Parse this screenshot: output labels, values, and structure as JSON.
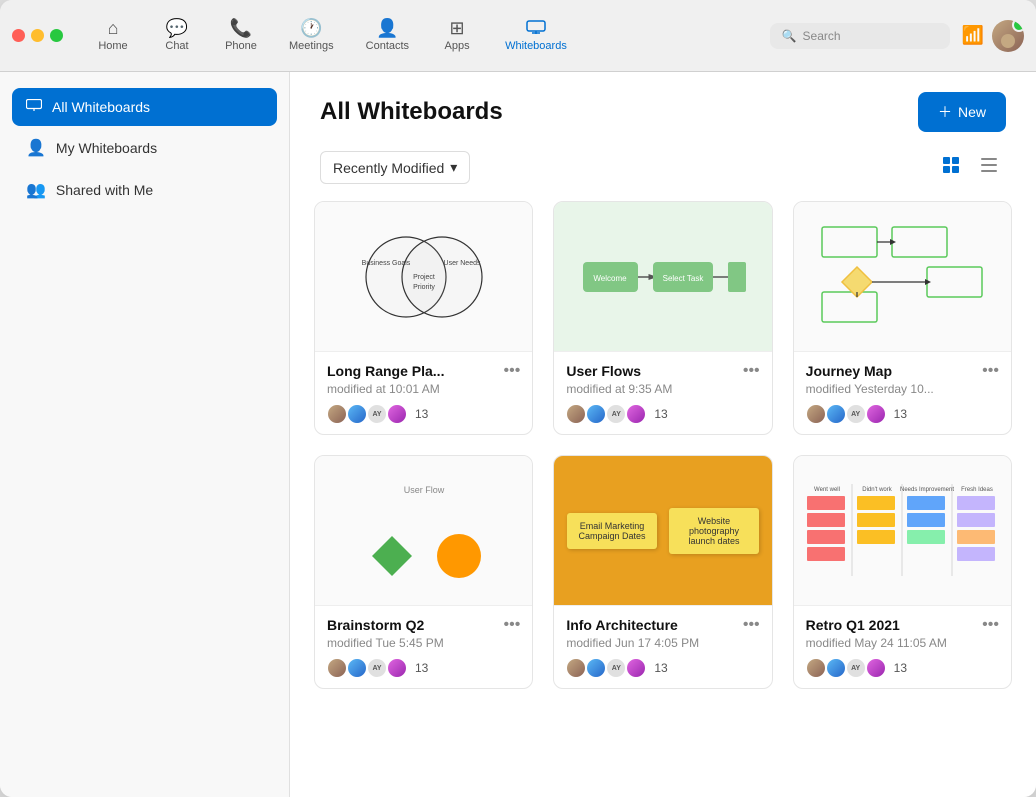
{
  "window": {
    "title": "Whiteboards"
  },
  "titlebar": {
    "traffic_lights": [
      "red",
      "yellow",
      "green"
    ],
    "nav": [
      {
        "id": "home",
        "label": "Home",
        "icon": "⌂"
      },
      {
        "id": "chat",
        "label": "Chat",
        "icon": "💬"
      },
      {
        "id": "phone",
        "label": "Phone",
        "icon": "📞"
      },
      {
        "id": "meetings",
        "label": "Meetings",
        "icon": "🕐"
      },
      {
        "id": "contacts",
        "label": "Contacts",
        "icon": "👤"
      },
      {
        "id": "apps",
        "label": "Apps",
        "icon": "⊞"
      },
      {
        "id": "whiteboards",
        "label": "Whiteboards",
        "icon": "▭",
        "active": true
      }
    ],
    "search": {
      "placeholder": "Search"
    },
    "new_button": "New"
  },
  "sidebar": {
    "items": [
      {
        "id": "all",
        "label": "All Whiteboards",
        "icon": "▭",
        "active": true
      },
      {
        "id": "my",
        "label": "My Whiteboards",
        "icon": "👤"
      },
      {
        "id": "shared",
        "label": "Shared with Me",
        "icon": "👥"
      }
    ]
  },
  "content": {
    "page_title": "All Whiteboards",
    "filter": {
      "label": "Recently Modified",
      "arrow": "▾"
    },
    "new_button": "New",
    "cards": [
      {
        "id": "long-range-plan",
        "title": "Long Range Pla...",
        "modified": "modified at 10:01 AM",
        "collaborators": 13,
        "thumbnail": "venn"
      },
      {
        "id": "user-flows",
        "title": "User Flows",
        "modified": "modified at 9:35 AM",
        "collaborators": 13,
        "thumbnail": "flow"
      },
      {
        "id": "journey-map",
        "title": "Journey Map",
        "modified": "modified Yesterday 10...",
        "collaborators": 13,
        "thumbnail": "journey"
      },
      {
        "id": "brainstorm-q2",
        "title": "Brainstorm Q2",
        "modified": "modified Tue 5:45 PM",
        "collaborators": 13,
        "thumbnail": "brainstorm"
      },
      {
        "id": "info-architecture",
        "title": "Info Architecture",
        "modified": "modified Jun 17 4:05 PM",
        "collaborators": 13,
        "thumbnail": "info"
      },
      {
        "id": "retro-q1-2021",
        "title": "Retro Q1 2021",
        "modified": "modified May 24 11:05 AM",
        "collaborators": 13,
        "thumbnail": "retro"
      }
    ]
  }
}
